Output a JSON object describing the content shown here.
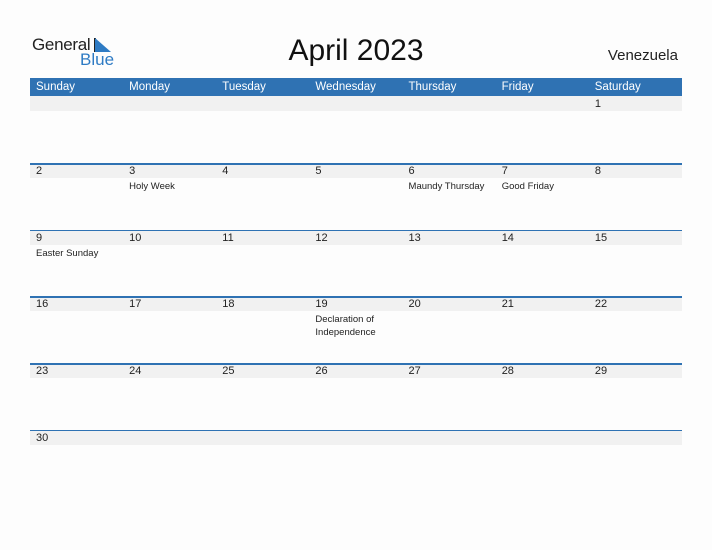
{
  "logo": {
    "line1": "General",
    "line2": "Blue"
  },
  "title": "April 2023",
  "country": "Venezuela",
  "colors": {
    "header_bg": "#2f72b3",
    "band_bg": "#f1f1f1",
    "logo_blue": "#2e7bc4"
  },
  "weekdays": [
    "Sunday",
    "Monday",
    "Tuesday",
    "Wednesday",
    "Thursday",
    "Friday",
    "Saturday"
  ],
  "weeks": [
    [
      {
        "day": ""
      },
      {
        "day": ""
      },
      {
        "day": ""
      },
      {
        "day": ""
      },
      {
        "day": ""
      },
      {
        "day": ""
      },
      {
        "day": "1"
      }
    ],
    [
      {
        "day": "2"
      },
      {
        "day": "3",
        "holiday": "Holy Week"
      },
      {
        "day": "4"
      },
      {
        "day": "5"
      },
      {
        "day": "6",
        "holiday": "Maundy Thursday"
      },
      {
        "day": "7",
        "holiday": "Good Friday"
      },
      {
        "day": "8"
      }
    ],
    [
      {
        "day": "9",
        "holiday": "Easter Sunday"
      },
      {
        "day": "10"
      },
      {
        "day": "11"
      },
      {
        "day": "12"
      },
      {
        "day": "13"
      },
      {
        "day": "14"
      },
      {
        "day": "15"
      }
    ],
    [
      {
        "day": "16"
      },
      {
        "day": "17"
      },
      {
        "day": "18"
      },
      {
        "day": "19",
        "holiday": "Declaration of Independence"
      },
      {
        "day": "20"
      },
      {
        "day": "21"
      },
      {
        "day": "22"
      }
    ],
    [
      {
        "day": "23"
      },
      {
        "day": "24"
      },
      {
        "day": "25"
      },
      {
        "day": "26"
      },
      {
        "day": "27"
      },
      {
        "day": "28"
      },
      {
        "day": "29"
      }
    ],
    [
      {
        "day": "30"
      },
      {
        "day": ""
      },
      {
        "day": ""
      },
      {
        "day": ""
      },
      {
        "day": ""
      },
      {
        "day": ""
      },
      {
        "day": ""
      }
    ]
  ]
}
